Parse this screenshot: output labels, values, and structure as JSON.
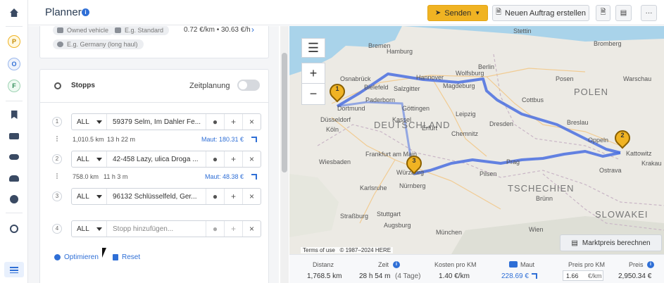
{
  "header": {
    "title": "Planner",
    "send_label": "Senden",
    "new_order_label": "Neuen Auftrag erstellen"
  },
  "rail": {
    "badges": [
      "P",
      "O",
      "F"
    ]
  },
  "vehicle": {
    "owned_label": "Owned vehicle",
    "standard_placeholder": "E.g. Standard",
    "rate": "0.72 €/km • 30.63 €/h",
    "region_placeholder": "E.g. Germany (long haul)"
  },
  "stops_section": {
    "title": "Stopps",
    "schedule_label": "Zeitplanung",
    "stops": [
      {
        "num": "1",
        "country": "ALL",
        "address": "59379 Selm, Im Dahler Fe..."
      },
      {
        "num": "2",
        "country": "ALL",
        "address": "42-458 Lazy, ulica Droga ..."
      },
      {
        "num": "3",
        "country": "ALL",
        "address": "96132 Schlüsselfeld, Ger..."
      },
      {
        "num": "4",
        "country": "ALL",
        "address": "",
        "placeholder": "Stopp hinzufügen..."
      }
    ],
    "legs": [
      {
        "distance": "1,010.5 km",
        "time": "13 h 22 m",
        "maut": "Maut: 180.31 €"
      },
      {
        "distance": "758.0 km",
        "time": "11 h 3 m",
        "maut": "Maut: 48.38 €"
      }
    ],
    "optimize_label": "Optimieren",
    "reset_label": "Reset"
  },
  "map": {
    "country_labels": [
      "DEUTSCHLAND",
      "POLEN",
      "TSCHECHIEN",
      "SLOWAKEI"
    ],
    "city_labels": [
      "Hamburg",
      "Bremen",
      "Berlin",
      "Stettin",
      "Bromberg",
      "Warschau",
      "Posen",
      "Hannover",
      "Magdeburg",
      "Osnabrück",
      "Bielefeld",
      "Salzgitter",
      "Dortmund",
      "Düsseldorf",
      "Köln",
      "Leipzig",
      "Dresden",
      "Breslau",
      "Frankfurt am Main",
      "Würzburg",
      "Nürnberg",
      "Prag",
      "Pilsen",
      "Brünn",
      "Ostrava",
      "Stuttgart",
      "Straßburg",
      "Augsburg",
      "München",
      "Wien",
      "Krakau",
      "Kattowitz",
      "Oppeln",
      "Wiesbaden",
      "Karlsruhe",
      "Chemnitz",
      "Erfurt",
      "Kassel",
      "Göttingen",
      "Paderborn",
      "Wolfsburg",
      "Cottbus"
    ],
    "terms_label": "Terms of use",
    "copyright": "© 1987–2024 HERE",
    "market_price_label": "Marktpreis berechnen",
    "route_color": "#4a6fe0",
    "marker_color": "#f0b323",
    "markers": [
      "1",
      "2",
      "3"
    ]
  },
  "stats": {
    "distance_label": "Distanz",
    "distance_value": "1,768.5 km",
    "time_label": "Zeit",
    "time_value": "28 h 54 m",
    "time_days": "(4 Tage)",
    "cost_label": "Kosten pro KM",
    "cost_value": "1.40 €/km",
    "maut_label": "Maut",
    "maut_value": "228.69 €",
    "price_km_label": "Preis pro KM",
    "price_km_value": "1.66",
    "price_km_unit": "€/km",
    "price_label": "Preis",
    "price_value": "2,950.34 €"
  },
  "colors": {
    "accent": "#2f6fd6",
    "send": "#f0b323"
  }
}
